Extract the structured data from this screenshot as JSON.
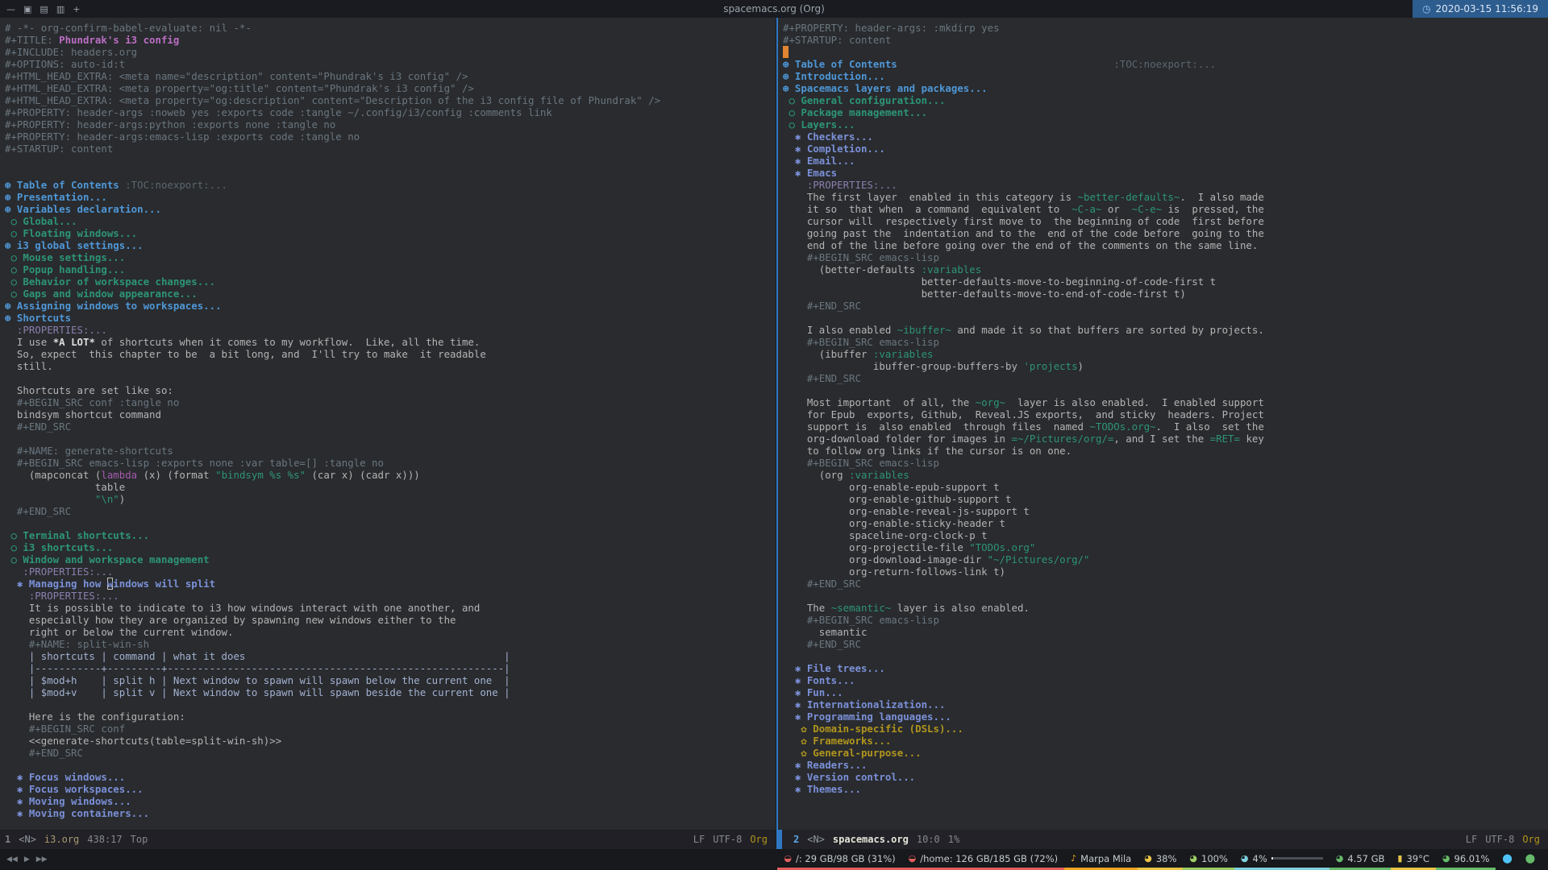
{
  "theme": {
    "accent_blue": "#4f97d7",
    "heading2_teal": "#2d9574",
    "heading3_violet": "#7b90d8",
    "heading4_gold": "#b1951d",
    "title_magenta": "#bc6ec5",
    "cursor_orange": "#e18532",
    "background": "#292b2e"
  },
  "titlebar": {
    "icons": [
      {
        "name": "layout-splith-icon",
        "glyph": "—"
      },
      {
        "name": "layout-stacking-icon",
        "glyph": "▣"
      },
      {
        "name": "layout-tabbed-icon",
        "glyph": "▤"
      },
      {
        "name": "layout-grid-icon",
        "glyph": "▥"
      },
      {
        "name": "workspace-add-icon",
        "glyph": "+"
      }
    ],
    "title": "spacemacs.org (Org)",
    "clock_icon": "◷",
    "clock": "2020-03-15 11:56:19"
  },
  "left_window": {
    "lines": [
      [
        [
          "cm",
          "# -*- org-confirm-babel-evaluate: nil -*-"
        ]
      ],
      [
        [
          "cm",
          "#+TITLE: "
        ],
        [
          "ttl",
          "Phundrak's i3 config"
        ]
      ],
      [
        [
          "cm",
          "#+INCLUDE: headers.org"
        ]
      ],
      [
        [
          "cm",
          "#+OPTIONS: auto-id:t"
        ]
      ],
      [
        [
          "cm",
          "#+HTML_HEAD_EXTRA: <meta name=\"description\" content=\"Phundrak's i3 config\" />"
        ]
      ],
      [
        [
          "cm",
          "#+HTML_HEAD_EXTRA: <meta property=\"og:title\" content=\"Phundrak's i3 config\" />"
        ]
      ],
      [
        [
          "cm",
          "#+HTML_HEAD_EXTRA: <meta property=\"og:description\" content=\"Description of the i3 config file of Phundrak\" />"
        ]
      ],
      [
        [
          "cm",
          "#+PROPERTY: header-args :noweb yes :exports code :tangle ~/.config/i3/config :comments link"
        ]
      ],
      [
        [
          "cm",
          "#+PROPERTY: header-args:python :exports none :tangle no"
        ]
      ],
      [
        [
          "cm",
          "#+PROPERTY: header-args:emacs-lisp :exports code :tangle no"
        ]
      ],
      [
        [
          "cm",
          "#+STARTUP: content"
        ]
      ],
      [],
      [],
      [
        [
          "h1",
          "⊛ Table of Contents "
        ],
        [
          "tag",
          ":TOC:noexport:..."
        ]
      ],
      [
        [
          "h1",
          "⊛ Presentation..."
        ]
      ],
      [
        [
          "h1",
          "⊛ Variables declaration..."
        ]
      ],
      [
        [
          "h2",
          " ○ Global..."
        ]
      ],
      [
        [
          "h2",
          " ○ Floating windows..."
        ]
      ],
      [
        [
          "h1",
          "⊛ i3 global settings..."
        ]
      ],
      [
        [
          "h2",
          " ○ Mouse settings..."
        ]
      ],
      [
        [
          "h2",
          " ○ Popup handling..."
        ]
      ],
      [
        [
          "h2",
          " ○ Behavior of workspace changes..."
        ]
      ],
      [
        [
          "h2",
          " ○ Gaps and window appearance..."
        ]
      ],
      [
        [
          "h1",
          "⊛ Assigning windows to workspaces..."
        ]
      ],
      [
        [
          "h1",
          "⊛ Shortcuts"
        ]
      ],
      [
        [
          "drw",
          "  :PROPERTIES:..."
        ]
      ],
      [
        [
          "txt",
          "  I use "
        ],
        [
          "b",
          "*A LOT*"
        ],
        [
          "txt",
          " of shortcuts when it comes to my workflow.  Like, all the time."
        ]
      ],
      [
        [
          "txt",
          "  So, expect  this chapter to be  a bit long, and  I'll try to make  it readable"
        ]
      ],
      [
        [
          "txt",
          "  still."
        ]
      ],
      [],
      [
        [
          "txt",
          "  Shortcuts are set like so:"
        ]
      ],
      [
        [
          "cm",
          "  #+BEGIN_SRC conf :tangle no"
        ]
      ],
      [
        [
          "txt",
          "  bindsym shortcut command"
        ]
      ],
      [
        [
          "cm",
          "  #+END_SRC"
        ]
      ],
      [],
      [
        [
          "cm",
          "  #+NAME: generate-shortcuts"
        ]
      ],
      [
        [
          "cm",
          "  #+BEGIN_SRC emacs-lisp :exports none :var table=[] :tangle no"
        ]
      ],
      [
        [
          "txt",
          "    (mapconcat ("
        ],
        [
          "fn",
          "lambda"
        ],
        [
          "txt",
          " (x) (format "
        ],
        [
          "str",
          "\"bindsym %s %s\""
        ],
        [
          "txt",
          " (car x) (cadr x)))"
        ]
      ],
      [
        [
          "txt",
          "               table"
        ]
      ],
      [
        [
          "txt",
          "               "
        ],
        [
          "str",
          "\"\\n\""
        ],
        [
          "txt",
          ")"
        ]
      ],
      [
        [
          "cm",
          "  #+END_SRC"
        ]
      ],
      [],
      [
        [
          "h2",
          " ○ Terminal shortcuts..."
        ]
      ],
      [
        [
          "h2",
          " ○ i3 shortcuts..."
        ]
      ],
      [
        [
          "h2",
          " ○ Window and workspace management"
        ]
      ],
      [
        [
          "drw",
          "   :PROPERTIES:..."
        ]
      ],
      [
        [
          "h3",
          "  ✱ Managing how "
        ],
        [
          "h3 hol",
          "w"
        ],
        [
          "h3",
          "indows will split"
        ]
      ],
      [
        [
          "drw",
          "    :PROPERTIES:..."
        ]
      ],
      [
        [
          "txt",
          "    It is possible to indicate to i3 how windows interact with one another, and"
        ]
      ],
      [
        [
          "txt",
          "    especially how they are organized by spawning new windows either to the"
        ]
      ],
      [
        [
          "txt",
          "    right or below the current window."
        ]
      ],
      [
        [
          "cm",
          "    #+NAME: split-win-sh"
        ]
      ],
      [
        [
          "tbl",
          "    | shortcuts | command | what it does                                           |"
        ]
      ],
      [
        [
          "tbl",
          "    |-----------+---------+--------------------------------------------------------|"
        ]
      ],
      [
        [
          "tbl",
          "    | $mod+h    | split h | Next window to spawn will spawn below the current one  |"
        ]
      ],
      [
        [
          "tbl",
          "    | $mod+v    | split v | Next window to spawn will spawn beside the current one |"
        ]
      ],
      [],
      [
        [
          "txt",
          "    Here is the configuration:"
        ]
      ],
      [
        [
          "cm",
          "    #+BEGIN_SRC conf"
        ]
      ],
      [
        [
          "txt",
          "    <<generate-shortcuts(table=split-win-sh)>>"
        ]
      ],
      [
        [
          "cm",
          "    #+END_SRC"
        ]
      ],
      [],
      [
        [
          "h3",
          "  ✱ Focus windows..."
        ]
      ],
      [
        [
          "h3",
          "  ✱ Focus workspaces..."
        ]
      ],
      [
        [
          "h3",
          "  ✱ Moving windows..."
        ]
      ],
      [
        [
          "h3",
          "  ✱ Moving containers..."
        ]
      ]
    ]
  },
  "right_window": {
    "lines": [
      [
        [
          "cm",
          "#+PROPERTY: header-args: :mkdirp yes"
        ]
      ],
      [
        [
          "cm",
          "#+STARTUP: content"
        ]
      ],
      [
        [
          "cur",
          " "
        ]
      ],
      [
        [
          "h1",
          "⊛ Table of Contents"
        ],
        [
          "txt",
          "                                    "
        ],
        [
          "tag",
          ":TOC:noexport:..."
        ]
      ],
      [
        [
          "h1",
          "⊛ Introduction..."
        ]
      ],
      [
        [
          "h1",
          "⊛ Spacemacs layers and packages..."
        ]
      ],
      [
        [
          "h2",
          " ○ General configuration..."
        ]
      ],
      [
        [
          "h2",
          " ○ Package management..."
        ]
      ],
      [
        [
          "h2",
          " ○ Layers..."
        ]
      ],
      [
        [
          "h3",
          "  ✱ Checkers..."
        ]
      ],
      [
        [
          "h3",
          "  ✱ Completion..."
        ]
      ],
      [
        [
          "h3",
          "  ✱ Email..."
        ]
      ],
      [
        [
          "h3",
          "  ✱ Emacs"
        ]
      ],
      [
        [
          "drw",
          "    :PROPERTIES:..."
        ]
      ],
      [
        [
          "txt",
          "    The first layer  enabled in this category is "
        ],
        [
          "code",
          "~better-defaults~"
        ],
        [
          "txt",
          ".  I also made"
        ]
      ],
      [
        [
          "txt",
          "    it so  that when  a command  equivalent to  "
        ],
        [
          "code",
          "~C-a~"
        ],
        [
          "txt",
          " or  "
        ],
        [
          "code",
          "~C-e~"
        ],
        [
          "txt",
          " is  pressed, the"
        ]
      ],
      [
        [
          "txt",
          "    cursor will  respectively first move to  the beginning of code  first before"
        ]
      ],
      [
        [
          "txt",
          "    going past the  indentation and to the  end of the code before  going to the"
        ]
      ],
      [
        [
          "txt",
          "    end of the line before going over the end of the comments on the same line."
        ]
      ],
      [
        [
          "cm",
          "    #+BEGIN_SRC emacs-lisp"
        ]
      ],
      [
        [
          "txt",
          "      (better-defaults "
        ],
        [
          "str",
          ":variables"
        ]
      ],
      [
        [
          "txt",
          "                       better-defaults-move-to-beginning-of-code-first t"
        ]
      ],
      [
        [
          "txt",
          "                       better-defaults-move-to-end-of-code-first t)"
        ]
      ],
      [
        [
          "cm",
          "    #+END_SRC"
        ]
      ],
      [],
      [
        [
          "txt",
          "    I also enabled "
        ],
        [
          "code",
          "~ibuffer~"
        ],
        [
          "txt",
          " and made it so that buffers are sorted by projects."
        ]
      ],
      [
        [
          "cm",
          "    #+BEGIN_SRC emacs-lisp"
        ]
      ],
      [
        [
          "txt",
          "      (ibuffer "
        ],
        [
          "str",
          ":variables"
        ]
      ],
      [
        [
          "txt",
          "               ibuffer-group-buffers-by "
        ],
        [
          "str",
          "'projects"
        ],
        [
          "txt",
          ")"
        ]
      ],
      [
        [
          "cm",
          "    #+END_SRC"
        ]
      ],
      [],
      [
        [
          "txt",
          "    Most important  of all, the "
        ],
        [
          "code",
          "~org~"
        ],
        [
          "txt",
          "  layer is also enabled.  I enabled support"
        ]
      ],
      [
        [
          "txt",
          "    for Epub  exports, Github,  Reveal.JS exports,  and sticky  headers. Project"
        ]
      ],
      [
        [
          "txt",
          "    support is  also enabled  through files  named "
        ],
        [
          "code",
          "~TODOs.org~"
        ],
        [
          "txt",
          ".  I also  set the"
        ]
      ],
      [
        [
          "txt",
          "    org-download folder for images in "
        ],
        [
          "code",
          "=~/Pictures/org/="
        ],
        [
          "txt",
          ", and I set the "
        ],
        [
          "code",
          "=RET="
        ],
        [
          "txt",
          " key"
        ]
      ],
      [
        [
          "txt",
          "    to follow org links if the cursor is on one."
        ]
      ],
      [
        [
          "cm",
          "    #+BEGIN_SRC emacs-lisp"
        ]
      ],
      [
        [
          "txt",
          "      (org "
        ],
        [
          "str",
          ":variables"
        ]
      ],
      [
        [
          "txt",
          "           org-enable-epub-support t"
        ]
      ],
      [
        [
          "txt",
          "           org-enable-github-support t"
        ]
      ],
      [
        [
          "txt",
          "           org-enable-reveal-js-support t"
        ]
      ],
      [
        [
          "txt",
          "           org-enable-sticky-header t"
        ]
      ],
      [
        [
          "txt",
          "           spaceline-org-clock-p t"
        ]
      ],
      [
        [
          "txt",
          "           org-projectile-file "
        ],
        [
          "str",
          "\"TODOs.org\""
        ]
      ],
      [
        [
          "txt",
          "           org-download-image-dir "
        ],
        [
          "str",
          "\"~/Pictures/org/\""
        ]
      ],
      [
        [
          "txt",
          "           org-return-follows-link t)"
        ]
      ],
      [
        [
          "cm",
          "    #+END_SRC"
        ]
      ],
      [],
      [
        [
          "txt",
          "    The "
        ],
        [
          "code",
          "~semantic~"
        ],
        [
          "txt",
          " layer is also enabled."
        ]
      ],
      [
        [
          "cm",
          "    #+BEGIN_SRC emacs-lisp"
        ]
      ],
      [
        [
          "txt",
          "      semantic"
        ]
      ],
      [
        [
          "cm",
          "    #+END_SRC"
        ]
      ],
      [],
      [
        [
          "h3",
          "  ✱ File trees..."
        ]
      ],
      [
        [
          "h3",
          "  ✱ Fonts..."
        ]
      ],
      [
        [
          "h3",
          "  ✱ Fun..."
        ]
      ],
      [
        [
          "h3",
          "  ✱ Internationalization..."
        ]
      ],
      [
        [
          "h3",
          "  ✱ Programming languages..."
        ]
      ],
      [
        [
          "h4",
          "   ✿ Domain-specific (DSLs)..."
        ]
      ],
      [
        [
          "h4",
          "   ✿ Frameworks..."
        ]
      ],
      [
        [
          "h4",
          "   ✿ General-purpose..."
        ]
      ],
      [
        [
          "h3",
          "  ✱ Readers..."
        ]
      ],
      [
        [
          "h3",
          "  ✱ Version control..."
        ]
      ],
      [
        [
          "h3",
          "  ✱ Themes..."
        ]
      ]
    ]
  },
  "left_modeline": {
    "window_number": "1",
    "state": "<N>",
    "buffer": "i3.org",
    "position": "438:17",
    "scroll": "Top",
    "eol": "LF",
    "encoding": "UTF-8",
    "mode": "Org"
  },
  "right_modeline": {
    "window_number": "2",
    "state": "<N>",
    "buffer": "spacemacs.org",
    "position": "10:0",
    "scroll": "1%",
    "eol": "LF",
    "encoding": "UTF-8",
    "mode": "Org"
  },
  "statusbar": {
    "player": [
      {
        "name": "previous-track-icon",
        "glyph": "◀◀"
      },
      {
        "name": "play-icon",
        "glyph": "▶"
      },
      {
        "name": "next-track-icon",
        "glyph": "▶▶"
      }
    ],
    "segments": [
      {
        "name": "disk-root",
        "icon": "◒",
        "label": "/: 29 GB/98 GB (31%)",
        "color": "#e25d5d",
        "underline": true
      },
      {
        "name": "disk-home",
        "icon": "◒",
        "label": "/home: 126 GB/185 GB (72%)",
        "color": "#e25d5d",
        "underline": true
      },
      {
        "name": "music-track",
        "icon": "♪",
        "label": "Marpa Mila",
        "color": "#f5a623",
        "underline": true
      },
      {
        "name": "volume",
        "icon": "◕",
        "label": "38%",
        "color": "#e8c547",
        "underline": true
      },
      {
        "name": "brightness",
        "icon": "◕",
        "label": "100%",
        "color": "#9ccc65",
        "underline": true
      },
      {
        "name": "microphone-level",
        "icon": "◕",
        "label": "4%",
        "color": "#7fd1e0",
        "underline": true,
        "bar": 4
      },
      {
        "name": "memory-usage",
        "icon": "◕",
        "label": "4.57 GB",
        "color": "#66bb6a",
        "underline": true
      },
      {
        "name": "temperature",
        "icon": "▮",
        "label": "39°C",
        "color": "#e8c547",
        "underline": true
      },
      {
        "name": "cpu-usage",
        "icon": "◕",
        "label": "96.01%",
        "color": "#66bb6a",
        "underline": true
      },
      {
        "name": "network-status",
        "icon": "⬤",
        "label": "",
        "color": "#4fc3f7",
        "underline": false
      },
      {
        "name": "battery-status",
        "icon": "⬤",
        "label": "",
        "color": "#66bb6a",
        "underline": false
      }
    ]
  }
}
